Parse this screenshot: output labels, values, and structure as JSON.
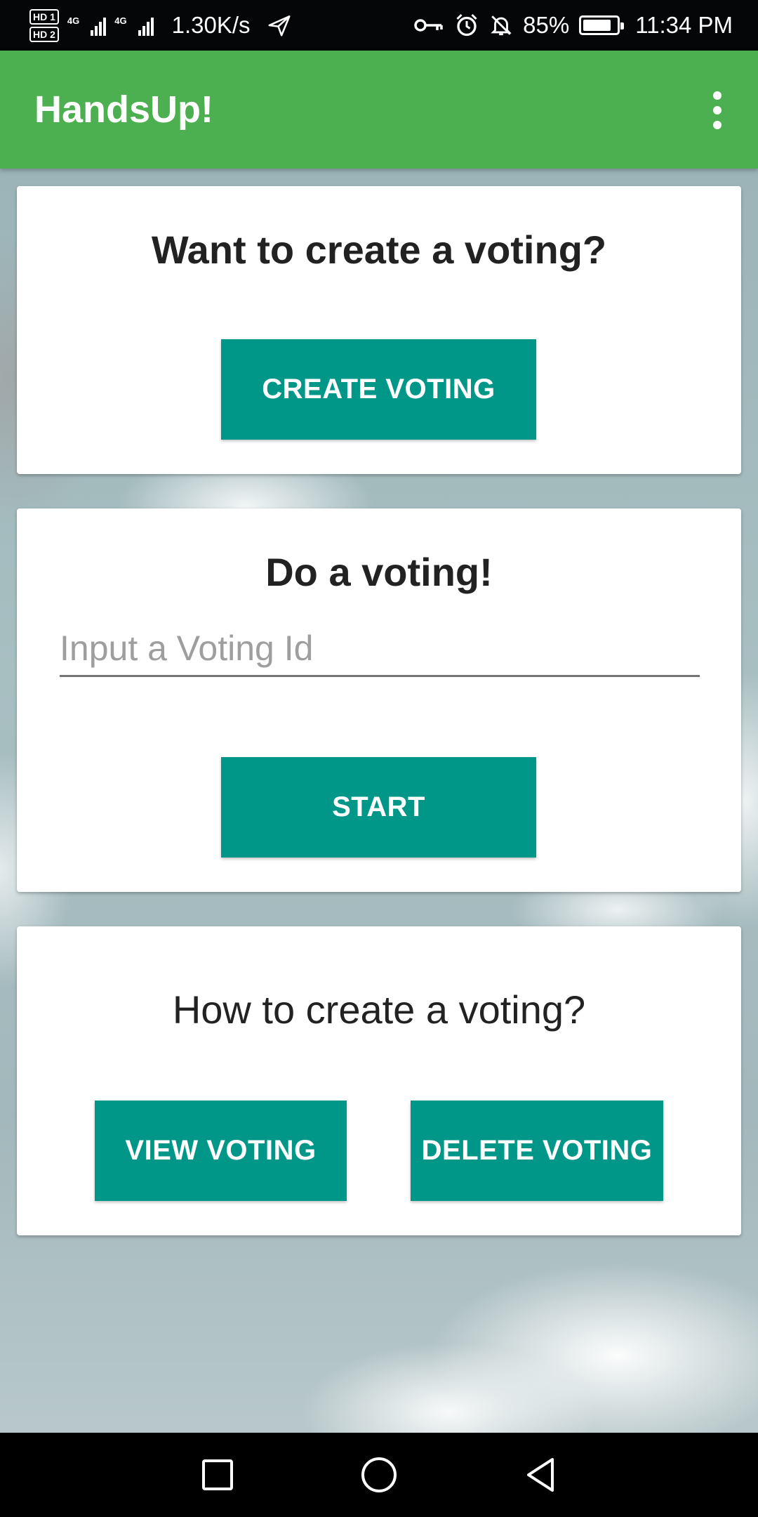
{
  "status_bar": {
    "hd_1": "HD",
    "sim_1": "1",
    "hd_2": "HD",
    "sim_2": "2",
    "net_1": "4G",
    "net_2": "4G",
    "speed": "1.30K/s",
    "battery_percent": "85%",
    "battery_level": 0.85,
    "time": "11:34 PM",
    "icons": [
      "hd-icon",
      "signal-icon",
      "airplane-icon",
      "key-icon",
      "alarm-icon",
      "bell-off-icon",
      "battery-icon"
    ]
  },
  "app_bar": {
    "title": "HandsUp!",
    "menu_icon": "more-vert-icon"
  },
  "create_card": {
    "title": "Want to create a voting?",
    "button_label": "CREATE VOTING"
  },
  "do_card": {
    "title": "Do a voting!",
    "input_placeholder": "Input a Voting Id",
    "input_value": "",
    "button_label": "START"
  },
  "how_card": {
    "title": "How to create a voting?",
    "view_button_label": "VIEW VOTING",
    "delete_button_label": "DELETE VOTING"
  },
  "nav_bar": {
    "icons": [
      "recents-square-icon",
      "home-circle-icon",
      "back-triangle-icon"
    ]
  },
  "colors": {
    "app_bar": "#4caf50",
    "button": "#009688",
    "status_bar": "#050608",
    "nav_bar": "#000000"
  }
}
